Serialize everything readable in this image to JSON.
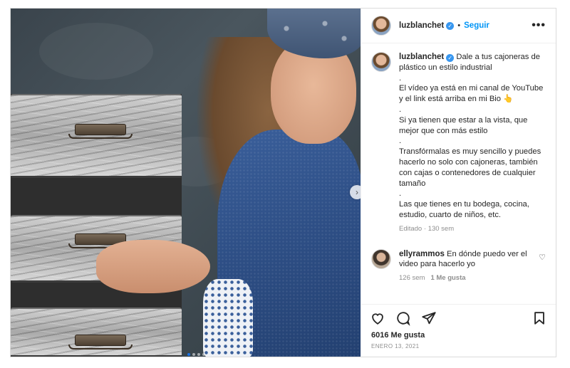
{
  "post": {
    "username": "luzblanchet",
    "follow_label": "Seguir",
    "more_label": "•••",
    "next_label": "›",
    "caption": {
      "username": "luzblanchet",
      "paragraphs": [
        "Dale a tus cajoneras de plástico un estilo industrial",
        ".",
        "El vídeo ya está en mi canal de YouTube y el link está arriba en mi Bio 👆",
        ".",
        "Si ya tienen que estar a la vista, que mejor que con más estilo",
        ".",
        "Transfórmalas es muy sencillo y puedes hacerlo no solo con cajoneras, también con cajas o contenedores de cualquier tamaño",
        ".",
        "Las que tienes en tu bodega, cocina, estudio, cuarto de niños, etc."
      ],
      "edited_label": "Editado",
      "time": "130 sem"
    },
    "comments": [
      {
        "username": "ellyrammos",
        "text": "En dónde puedo ver el video para hacerlo yo",
        "time": "126 sem",
        "likes": "1 Me gusta"
      }
    ],
    "likes": "6016 Me gusta",
    "date": "ENERO 13, 2021",
    "carousel": {
      "slides": 4,
      "active_index": 0
    }
  }
}
